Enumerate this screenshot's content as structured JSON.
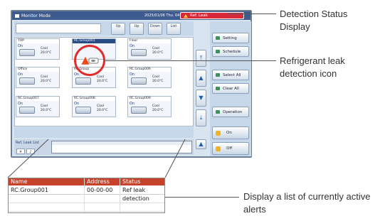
{
  "titlebar": {
    "title": "Monitor Mode",
    "datetime": "2025/01/06 Thu. 04:23 PM",
    "alert_label": "Ref. Leak"
  },
  "toolbar": {
    "buttons": [
      "Up",
      "Up",
      "Down",
      "List"
    ]
  },
  "groups": [
    {
      "name": "TOP",
      "state": "On",
      "mode": "Cool",
      "temp": "20.0°C",
      "selected": false
    },
    {
      "name": "RC.Group001",
      "state": "",
      "mode": "",
      "temp": "",
      "selected": true
    },
    {
      "name": "Floor",
      "state": "On",
      "mode": "Cool",
      "temp": "20.0°C",
      "selected": false
    },
    {
      "name": "Office",
      "state": "On",
      "mode": "Cool",
      "temp": "20.0°C",
      "selected": false
    },
    {
      "name": "RC.Group",
      "state": "On",
      "mode": "Cool",
      "temp": "20.0°C",
      "selected": false
    },
    {
      "name": "RC.Group006",
      "state": "On",
      "mode": "Cool",
      "temp": "20.0°C",
      "selected": false
    },
    {
      "name": "RC.Group007",
      "state": "On",
      "mode": "Cool",
      "temp": "20.0°C",
      "selected": false
    },
    {
      "name": "RC.Group008",
      "state": "On",
      "mode": "Cool",
      "temp": "20.0°C",
      "selected": false
    },
    {
      "name": "RC.Group009",
      "state": "On",
      "mode": "Cool",
      "temp": "20.0°C",
      "selected": false
    }
  ],
  "side_buttons": [
    "Setting",
    "Schedule",
    "Select All",
    "Clear All",
    "Operation"
  ],
  "onoff": {
    "on": "On",
    "off": "Off"
  },
  "alert_list": {
    "label": "Ref. Leak List",
    "columns": [
      "Name",
      "Address",
      "Status"
    ],
    "rows": [
      {
        "name": "RC.Group001",
        "address": "00-00-00",
        "status": "Ref leak detection"
      }
    ]
  },
  "callouts": {
    "detection_status": "Detection Status Display",
    "leak_icon": "Refrigerant leak detection icon",
    "active_alerts": "Display a list of currently active alerts"
  },
  "colors": {
    "alert_red": "#d8293b",
    "title_blue": "#3d5b8f",
    "highlight_red": "#e32a2a"
  }
}
